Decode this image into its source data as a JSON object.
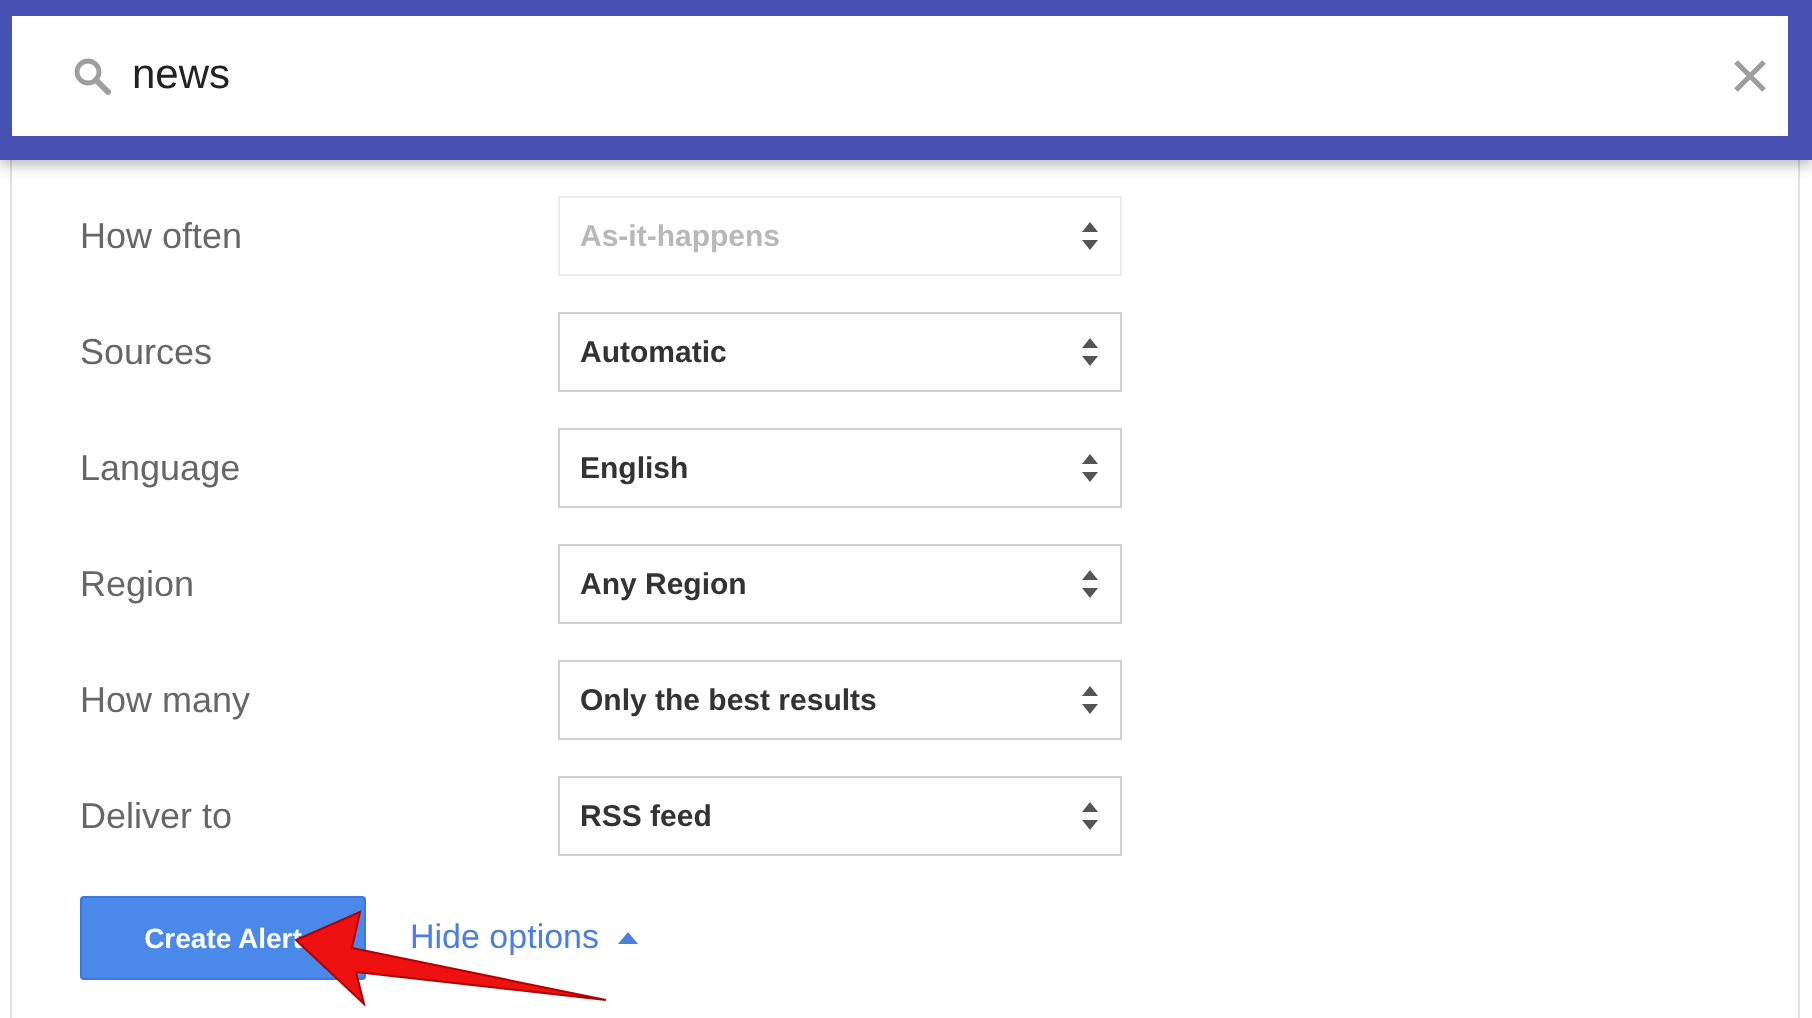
{
  "search": {
    "value": "news"
  },
  "options": [
    {
      "label": "How often",
      "value": "As-it-happens",
      "disabled": true
    },
    {
      "label": "Sources",
      "value": "Automatic",
      "disabled": false
    },
    {
      "label": "Language",
      "value": "English",
      "disabled": false
    },
    {
      "label": "Region",
      "value": "Any Region",
      "disabled": false
    },
    {
      "label": "How many",
      "value": "Only the best results",
      "disabled": false
    },
    {
      "label": "Deliver to",
      "value": "RSS feed",
      "disabled": false
    }
  ],
  "create_button": "Create Alert",
  "hide_options_link": "Hide options"
}
